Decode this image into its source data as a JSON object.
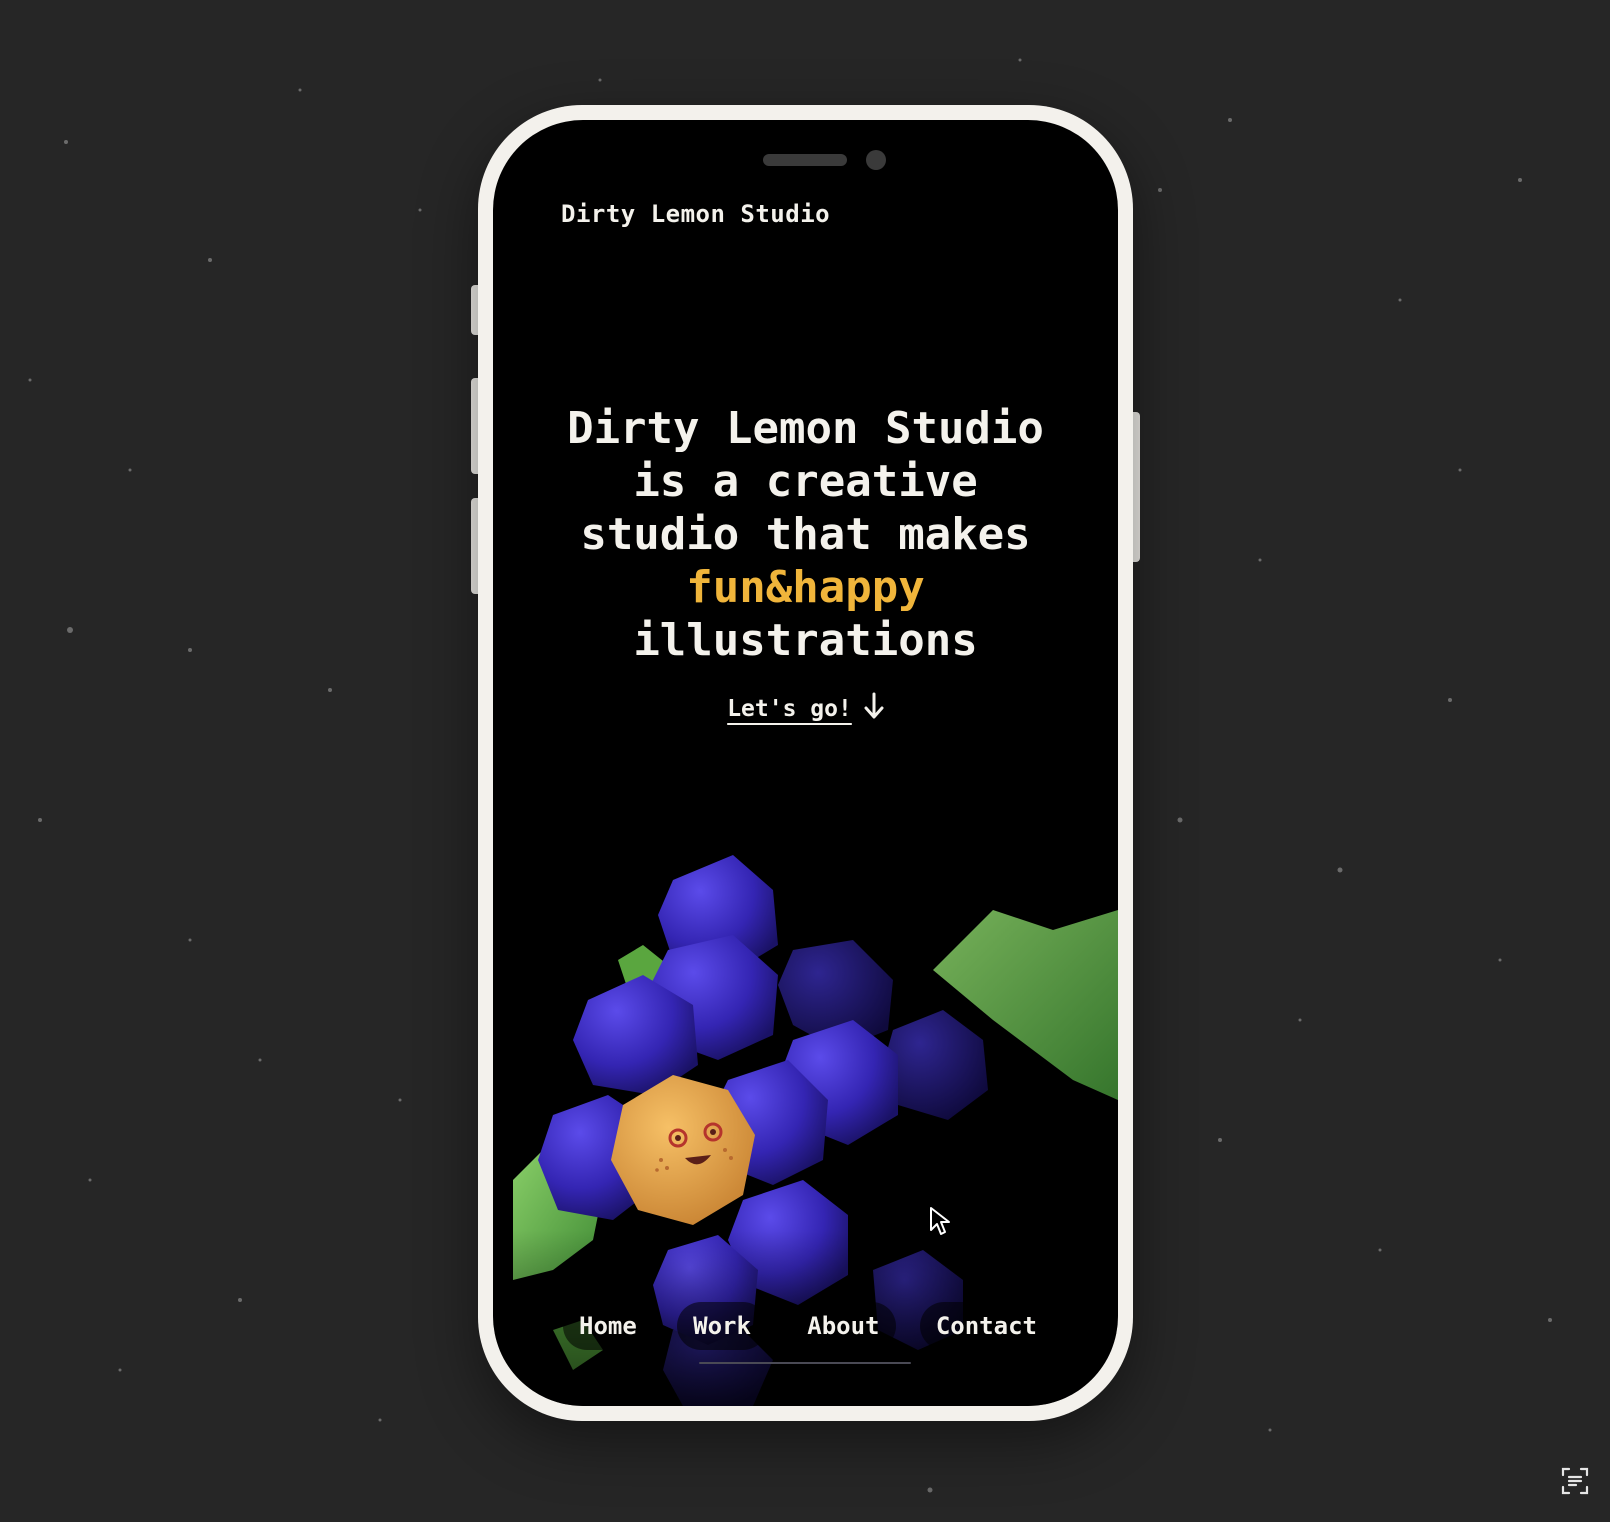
{
  "site": {
    "brand": "Dirty Lemon Studio"
  },
  "hero": {
    "line1": "Dirty Lemon Studio",
    "line2": "is a creative",
    "line3": "studio that makes",
    "highlight": "fun&happy",
    "line5": "illustrations"
  },
  "cta": {
    "label": "Let's go!",
    "icon": "arrow-down-icon"
  },
  "nav": {
    "items": [
      {
        "label": "Home"
      },
      {
        "label": "Work"
      },
      {
        "label": "About"
      },
      {
        "label": "Contact"
      }
    ]
  },
  "colors": {
    "background": "#262626",
    "phone_frame": "#f3f1ec",
    "screen": "#000000",
    "text": "#f4f2ec",
    "accent": "#f0b53b",
    "grape": "#3f2fc0",
    "leaf": "#6fb24a",
    "lemon": "#e6a948"
  },
  "illustration": {
    "subject": "grapes-with-smiling-fruit-illustration"
  },
  "overlay": {
    "icon": "text-scan-icon"
  }
}
